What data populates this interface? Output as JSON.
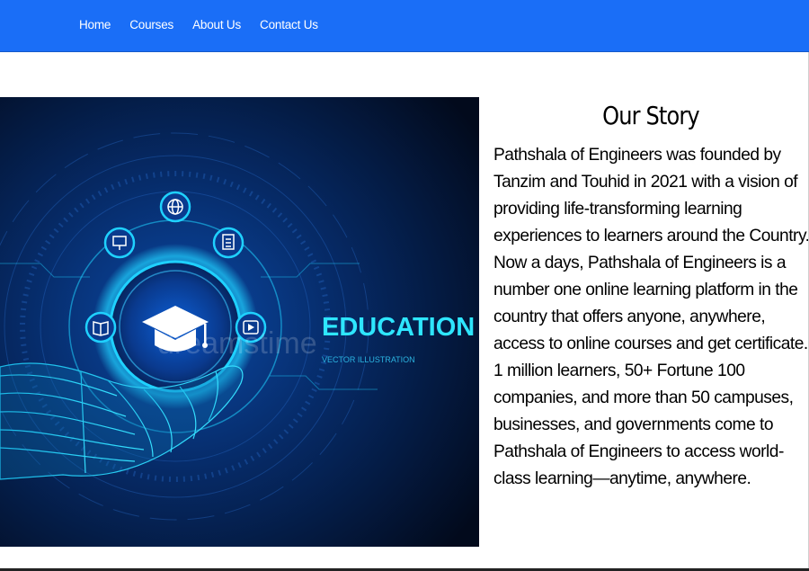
{
  "nav": {
    "items": [
      {
        "label": "Home"
      },
      {
        "label": "Courses"
      },
      {
        "label": "About Us"
      },
      {
        "label": "Contact Us"
      }
    ]
  },
  "hero": {
    "heading": "EDUCATION",
    "subheading": "VECTOR ILLUSTRATION",
    "watermark": "dreamstime"
  },
  "story": {
    "title": "Our Story",
    "body": "Pathshala of Engineers was founded by Tanzim and Touhid in 2021 with a vision of providing life-transforming learning experiences to learners around the Country. Now a days, Pathshala of Engineers is a number one online learning platform in the country that offers anyone, anywhere, access to online courses and get certificate. 1 million learners, 50+ Fortune 100 companies, and more than 50 campuses, businesses, and governments come to Pathshala of Engineers to access world-class learning—anytime, anywhere."
  },
  "colors": {
    "navbar": "#1a6ef7",
    "hero_bg": "#041633",
    "glow": "#1fd1ff"
  }
}
